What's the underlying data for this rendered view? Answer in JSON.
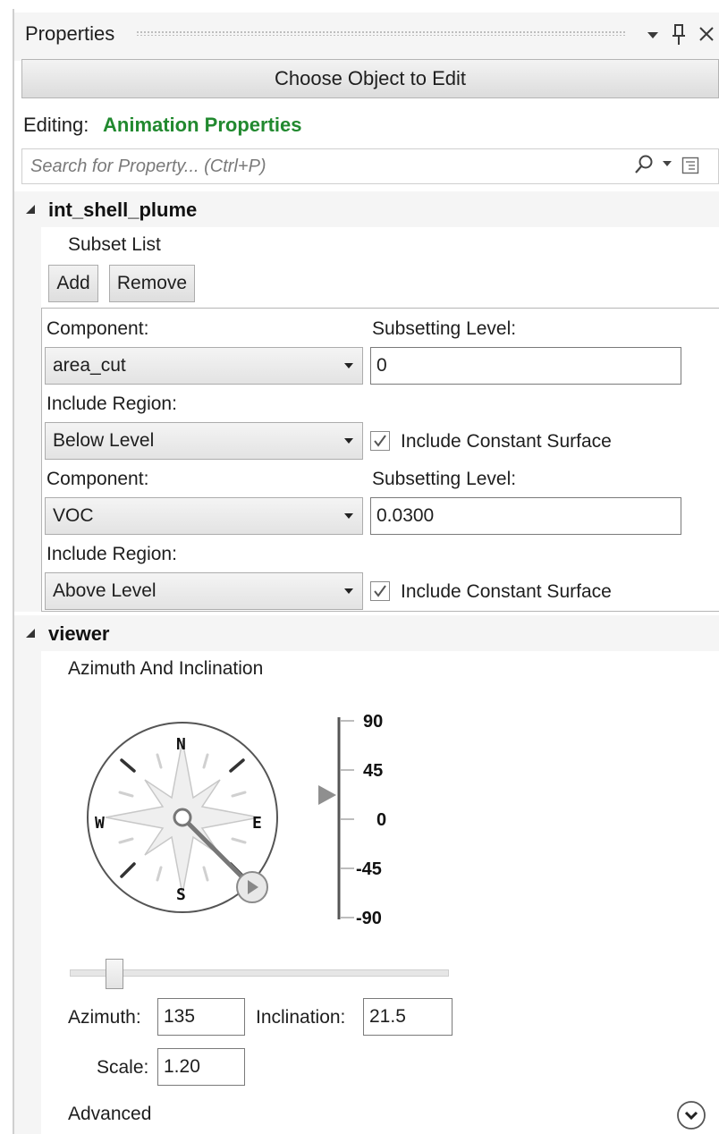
{
  "panel": {
    "title": "Properties",
    "icons": [
      "dropdown-icon",
      "pin-icon",
      "close-icon"
    ],
    "choose_button": "Choose Object to Edit",
    "editing_label": "Editing:",
    "editing_value": "Animation Properties",
    "search_placeholder": "Search for Property...  (Ctrl+P)"
  },
  "sections": {
    "plume": {
      "title": "int_shell_plume",
      "subset_list_label": "Subset List",
      "add_label": "Add",
      "remove_label": "Remove",
      "subsets": [
        {
          "component_label": "Component:",
          "component_value": "area_cut",
          "level_label": "Subsetting Level:",
          "level_value": "0",
          "region_label": "Include Region:",
          "region_value": "Below Level",
          "constant_surface_label": "Include Constant Surface",
          "constant_surface_checked": true
        },
        {
          "component_label": "Component:",
          "component_value": "VOC",
          "level_label": "Subsetting Level:",
          "level_value": "0.0300",
          "region_label": "Include Region:",
          "region_value": "Above Level",
          "constant_surface_label": "Include Constant Surface",
          "constant_surface_checked": true
        }
      ]
    },
    "viewer": {
      "title": "viewer",
      "group_label": "Azimuth And Inclination",
      "compass": {
        "n": "N",
        "s": "S",
        "e": "E",
        "w": "W"
      },
      "inclination_ticks": [
        "90",
        "45",
        "0",
        "-45",
        "-90"
      ],
      "azimuth_label": "Azimuth:",
      "azimuth_value": "135",
      "inclination_label": "Inclination:",
      "inclination_value": "21.5",
      "scale_label": "Scale:",
      "scale_value": "1.20",
      "advanced_label": "Advanced"
    }
  },
  "colors": {
    "editing_value": "#21892f",
    "header_bg": "#f5f5f5"
  }
}
